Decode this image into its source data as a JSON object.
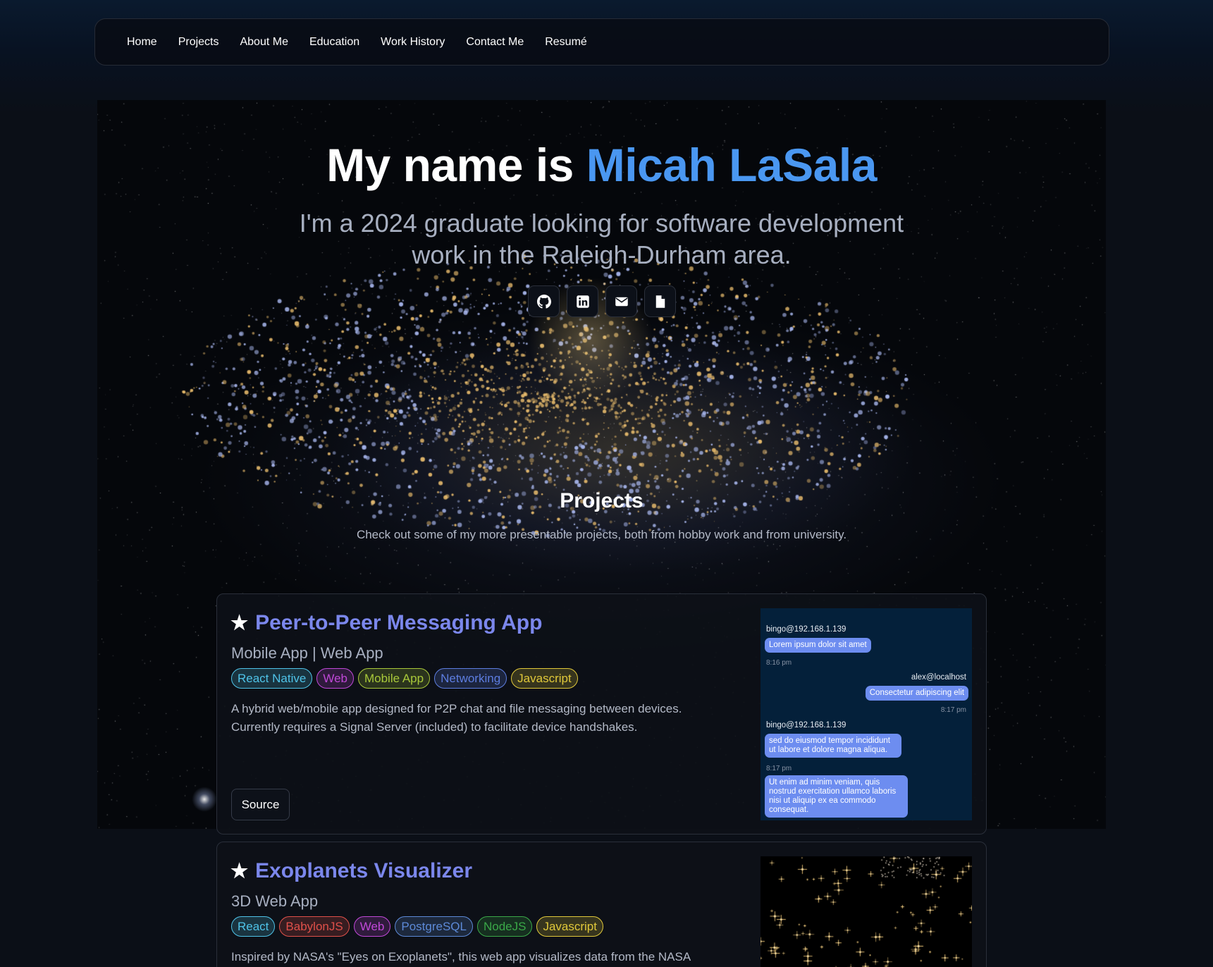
{
  "nav": {
    "items": [
      "Home",
      "Projects",
      "About Me",
      "Education",
      "Work History",
      "Contact Me",
      "Resumé"
    ]
  },
  "hero": {
    "title_prefix": "My name is ",
    "title_name": "Micah LaSala",
    "subtitle": "I'm a 2024 graduate looking for software development work in the Raleigh-Durham area.",
    "social_icons": [
      "github-icon",
      "linkedin-icon",
      "mail-icon",
      "document-icon"
    ]
  },
  "projects_section": {
    "title": "Projects",
    "description": "Check out some of my more presentable projects, both from hobby work and from university."
  },
  "colors": {
    "accent_blue": "#4a97f1",
    "project_title": "#7b87ec",
    "chat_bubble": "#6d8df0"
  },
  "projects": [
    {
      "title": "Peer-to-Peer Messaging App",
      "type": "Mobile App | Web App",
      "tags": [
        {
          "label": "React Native",
          "color": "#4fc3e8"
        },
        {
          "label": "Web",
          "color": "#c048d8"
        },
        {
          "label": "Mobile App",
          "color": "#a8c83a"
        },
        {
          "label": "Networking",
          "color": "#5d7de0"
        },
        {
          "label": "Javascript",
          "color": "#e0c83a"
        }
      ],
      "description": "A hybrid web/mobile app designed for P2P chat and file messaging between devices. Currently requires a Signal Server (included) to facilitate device handshakes.",
      "button": "Source",
      "chat": {
        "user1": "bingo@192.168.1.139",
        "msg1": "Lorem ipsum dolor sit amet",
        "time1": "8:16 pm",
        "user2": "alex@localhost",
        "msg2": "Consectetur adipiscing elit",
        "time2": "8:17 pm",
        "user3": "bingo@192.168.1.139",
        "msg3": "sed do eiusmod tempor incididunt ut labore et dolore magna aliqua.",
        "time3": "8:17 pm",
        "msg4": "Ut enim ad minim veniam, quis nostrud exercitation ullamco laboris nisi ut aliquip ex ea commodo consequat."
      }
    },
    {
      "title": "Exoplanets Visualizer",
      "type": "3D Web App",
      "tags": [
        {
          "label": "React",
          "color": "#4fc3e8"
        },
        {
          "label": "BabylonJS",
          "color": "#e0504a"
        },
        {
          "label": "Web",
          "color": "#c048d8"
        },
        {
          "label": "PostgreSQL",
          "color": "#5d8ad8"
        },
        {
          "label": "NodeJS",
          "color": "#3aa848"
        },
        {
          "label": "Javascript",
          "color": "#e0c83a"
        }
      ],
      "description": "Inspired by NASA's \"Eyes on Exoplanets\", this web app visualizes data from the NASA"
    }
  ]
}
